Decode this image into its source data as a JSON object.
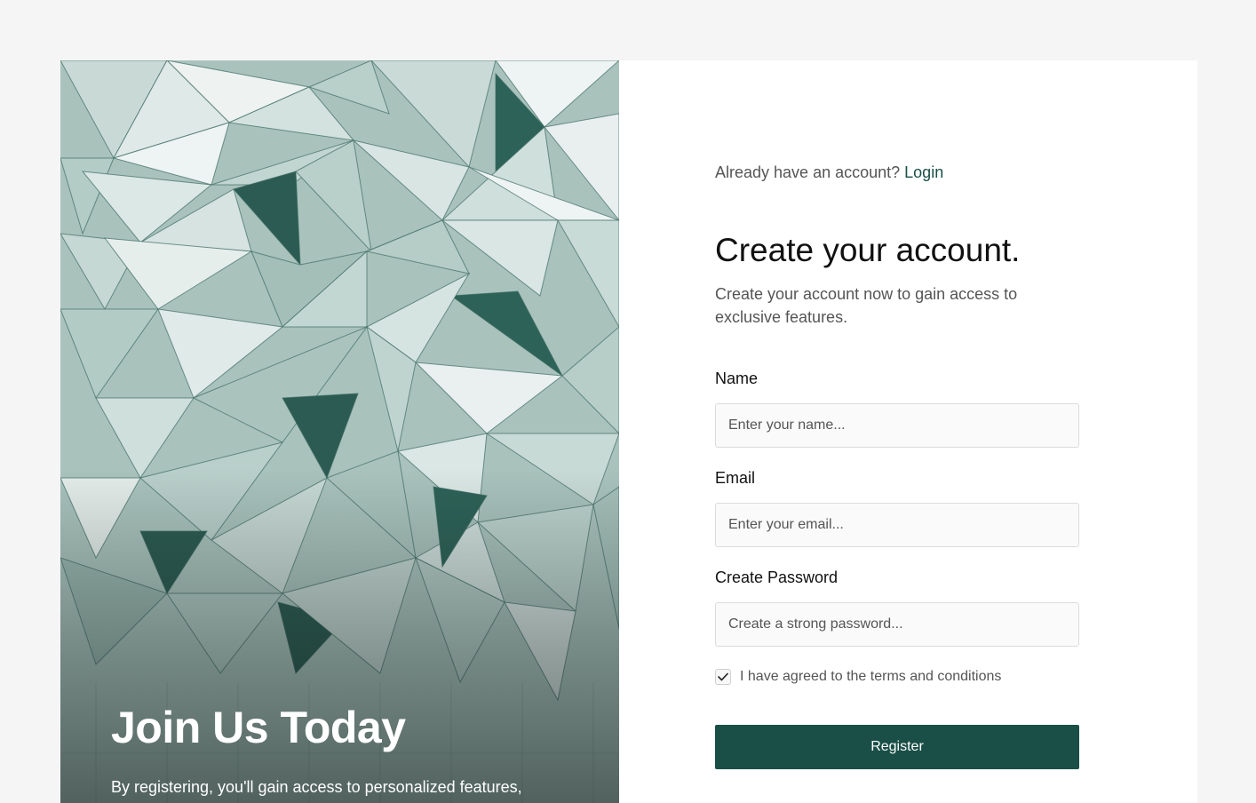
{
  "hero": {
    "title": "Join Us Today",
    "text": "By registering, you'll gain access to personalized features, special offers, and valuable resources tailored just for you."
  },
  "form": {
    "login_prompt": "Already have an account? ",
    "login_link": "Login",
    "heading": "Create your account.",
    "subtext": "Create your account now to gain access to exclusive features.",
    "fields": {
      "name": {
        "label": "Name",
        "placeholder": "Enter your name..."
      },
      "email": {
        "label": "Email",
        "placeholder": "Enter your email..."
      },
      "password": {
        "label": "Create Password",
        "placeholder": "Create a strong password..."
      }
    },
    "terms": {
      "label": "I have agreed to the terms and conditions",
      "checked": true
    },
    "register_label": "Register"
  },
  "colors": {
    "accent": "#1a4f47",
    "page_background": "#f5f5f5",
    "card_background": "#ffffff"
  }
}
